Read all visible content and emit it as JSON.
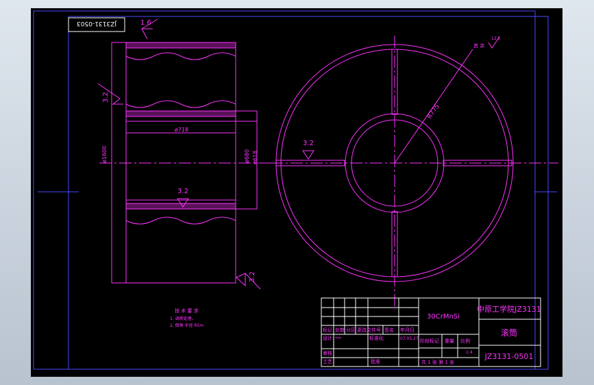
{
  "drawing": {
    "code_box_mirrored": "JZ3131-0503",
    "roughness": {
      "top": "1.6",
      "left": "3.2",
      "inner": "3.2",
      "bottom_right": "3.2",
      "right_view": "3.2"
    },
    "dimensions": {
      "outer_diameter": "ø1600",
      "bore_diameter": "ø718",
      "hub_d1": "ø680",
      "hub_d2": "ø618",
      "radius": "R775"
    },
    "corner_note": {
      "label": "其 余",
      "value": "12.5"
    },
    "tech_requirements": {
      "title": "技 术 要 求",
      "items": [
        "1. 调质处理。",
        "2. 倒角 半径 R5m"
      ]
    }
  },
  "title_block": {
    "material": "30CrMnSi",
    "school": "中原工学院JZ3131",
    "part_name": "滚筒",
    "drawing_no": "JZ3131-0501",
    "header_row": [
      "标记",
      "处数",
      "分区",
      "更改文件号",
      "签名",
      "年月日"
    ],
    "designer_label": "设计",
    "designer_value": "***",
    "standardize_label": "标准化",
    "date_value": "07.05.27",
    "stage_labels": [
      "阶段标记",
      "重量",
      "比例"
    ],
    "scale": "1:4",
    "review_label": "审核",
    "process_label": "工艺",
    "approve_label": "批准",
    "sheet_text": "共 1 张 第 1 张"
  }
}
